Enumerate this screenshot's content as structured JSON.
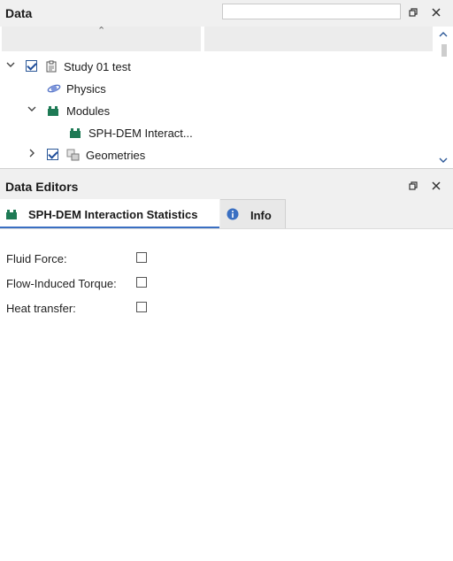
{
  "data_panel": {
    "title": "Data",
    "search": {
      "value": "",
      "placeholder": ""
    },
    "tree": [
      {
        "label": "Study 01 test",
        "expanded": true,
        "checked": true,
        "icon": "clipboard-icon"
      },
      {
        "label": "Physics",
        "icon": "planet-icon"
      },
      {
        "label": "Modules",
        "expanded": true,
        "icon": "modules-icon"
      },
      {
        "label": "SPH-DEM Interact...",
        "icon": "modules-icon"
      },
      {
        "label": "Geometries",
        "expanded": false,
        "checked": true,
        "icon": "geometries-icon"
      }
    ]
  },
  "editors_panel": {
    "title": "Data Editors",
    "tabs": [
      {
        "label": "SPH-DEM Interaction Statistics",
        "icon": "modules-icon",
        "active": true
      },
      {
        "label": "Info",
        "icon": "info-icon",
        "active": false
      }
    ],
    "fields": [
      {
        "label": "Fluid Force:",
        "checked": false
      },
      {
        "label": "Flow-Induced Torque:",
        "checked": false
      },
      {
        "label": "Heat transfer:",
        "checked": false
      }
    ]
  },
  "colors": {
    "accent": "#3a6fc2",
    "module_green": "#1e7a55",
    "physics_blue": "#5a78c8"
  }
}
